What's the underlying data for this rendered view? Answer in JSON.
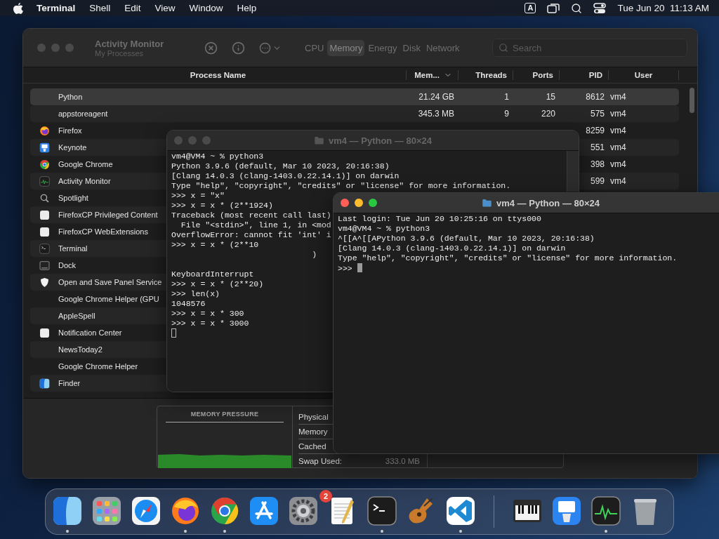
{
  "menu_bar": {
    "app": "Terminal",
    "menus": [
      "Shell",
      "Edit",
      "View",
      "Window",
      "Help"
    ],
    "input_source": "A",
    "clock": "Tue Jun 20  11:13 AM"
  },
  "activity_monitor": {
    "title": "Activity Monitor",
    "subtitle": "My Processes",
    "focused": false,
    "tabs": [
      {
        "label": "CPU",
        "selected": false
      },
      {
        "label": "Memory",
        "selected": true
      },
      {
        "label": "Energy",
        "selected": false
      },
      {
        "label": "Disk",
        "selected": false
      },
      {
        "label": "Network",
        "selected": false
      }
    ],
    "search": {
      "placeholder": "Search"
    },
    "columns": [
      {
        "label": "Process Name"
      },
      {
        "label": "Mem...",
        "sorted": true
      },
      {
        "label": "Threads"
      },
      {
        "label": "Ports"
      },
      {
        "label": "PID"
      },
      {
        "label": "User"
      }
    ],
    "rows": [
      {
        "kind": "none",
        "name": "Python",
        "memory": "21.24 GB",
        "threads": "1",
        "ports": "15",
        "pid": "8612",
        "user": "vm4",
        "selected": true
      },
      {
        "kind": "none",
        "name": "appstoreagent",
        "memory": "345.3 MB",
        "threads": "9",
        "ports": "220",
        "pid": "575",
        "user": "vm4",
        "selected": false
      },
      {
        "kind": "firefox",
        "name": "Firefox",
        "pid": "8259",
        "user": "vm4",
        "selected": false
      },
      {
        "kind": "keynote",
        "name": "Keynote",
        "pid": "551",
        "user": "vm4",
        "selected": false
      },
      {
        "kind": "chrome",
        "name": "Google Chrome",
        "pid": "398",
        "user": "vm4",
        "selected": false
      },
      {
        "kind": "activity",
        "name": "Activity Monitor",
        "pid": "599",
        "user": "vm4",
        "selected": false
      },
      {
        "kind": "spotlight",
        "name": "Spotlight",
        "selected": false
      },
      {
        "kind": "blank",
        "name": "FirefoxCP Privileged Content",
        "selected": false
      },
      {
        "kind": "blank",
        "name": "FirefoxCP WebExtensions",
        "selected": false
      },
      {
        "kind": "terminal",
        "name": "Terminal",
        "selected": false
      },
      {
        "kind": "dock",
        "name": "Dock",
        "selected": false
      },
      {
        "kind": "shield",
        "name": "Open and Save Panel Service",
        "selected": false
      },
      {
        "kind": "none",
        "name": "Google Chrome Helper (GPU",
        "selected": false
      },
      {
        "kind": "none",
        "name": "AppleSpell",
        "selected": false
      },
      {
        "kind": "blank",
        "name": "Notification Center",
        "selected": false
      },
      {
        "kind": "none",
        "name": "NewsToday2",
        "selected": false
      },
      {
        "kind": "none",
        "name": "Google Chrome Helper",
        "selected": false
      },
      {
        "kind": "finder",
        "name": "Finder",
        "selected": false
      }
    ],
    "memory_panel": {
      "title": "MEMORY PRESSURE",
      "stats": [
        {
          "label": "Physical"
        },
        {
          "label": "Memory"
        },
        {
          "label": "Cached"
        },
        {
          "label": "Swap Used:",
          "value": "333.0 MB"
        }
      ]
    }
  },
  "terminals": [
    {
      "title": "vm4 — Python — 80×24",
      "focused": false,
      "lines": [
        {
          "text": "vm4@VM4 ~ % python3"
        },
        {
          "text": "Python 3.9.6 (default, Mar 10 2023, 20:16:38)"
        },
        {
          "text": "[Clang 14.0.3 (clang-1403.0.22.14.1)] on darwin"
        },
        {
          "text": "Type \"help\", \"copyright\", \"credits\" or \"license\" for more information."
        },
        {
          "text": ">>> x = \"x\""
        },
        {
          "text": ">>> x = x * (2**1924)"
        },
        {
          "text": "Traceback (most recent call last)"
        },
        {
          "text": "  File \"<stdin>\", line 1, in <mod"
        },
        {
          "text": "OverflowError: cannot fit 'int' i"
        },
        {
          "text": ">>> x = x * (2**10"
        },
        {
          "text": "                             )"
        },
        {
          "kind": "blank"
        },
        {
          "text": "KeyboardInterrupt"
        },
        {
          "text": ">>> x = x * (2**20)"
        },
        {
          "text": ">>> len(x)"
        },
        {
          "text": "1048576"
        },
        {
          "text": ">>> x = x * 300"
        },
        {
          "text": ">>> x = x * 3000"
        },
        {
          "kind": "prompt",
          "cursor": true
        }
      ]
    },
    {
      "title": "vm4 — Python — 80×24",
      "focused": true,
      "lines": [
        {
          "text": "Last login: Tue Jun 20 10:25:16 on ttys000"
        },
        {
          "text": "vm4@VM4 ~ % python3"
        },
        {
          "text": "^[[A^[[APython 3.9.6 (default, Mar 10 2023, 20:16:38)"
        },
        {
          "text": "[Clang 14.0.3 (clang-1403.0.22.14.1)] on darwin"
        },
        {
          "text": "Type \"help\", \"copyright\", \"credits\" or \"license\" for more information."
        },
        {
          "text": ">>>",
          "cursor": true
        }
      ]
    }
  ],
  "dock": {
    "apps": [
      {
        "kind": "finder",
        "running": true
      },
      {
        "kind": "launchpad",
        "running": false
      },
      {
        "kind": "safari",
        "running": false
      },
      {
        "kind": "firefox",
        "running": true
      },
      {
        "kind": "chrome",
        "running": true
      },
      {
        "kind": "appstore",
        "running": false
      },
      {
        "kind": "settings",
        "running": false,
        "badge": "2"
      },
      {
        "kind": "textedit",
        "running": false
      },
      {
        "kind": "terminal",
        "running": true
      },
      {
        "kind": "guitar",
        "running": false
      },
      {
        "kind": "vscode",
        "running": true
      }
    ],
    "others": [
      {
        "kind": "piano",
        "running": false
      },
      {
        "kind": "keynote",
        "running": false
      },
      {
        "kind": "activity",
        "running": true
      },
      {
        "kind": "trash",
        "running": false
      }
    ]
  }
}
